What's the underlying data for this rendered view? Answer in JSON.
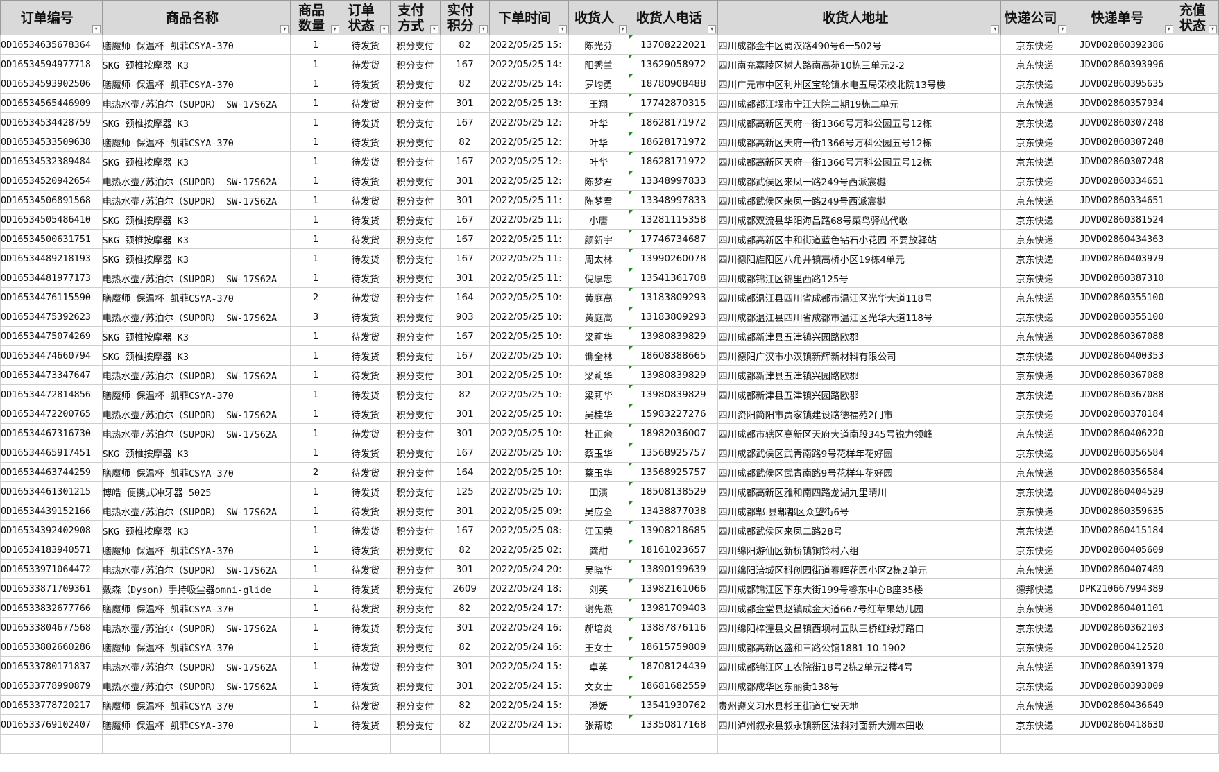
{
  "sheet": {
    "headers": [
      {
        "key": "order_id",
        "label": "订单编号"
      },
      {
        "key": "product",
        "label": "商品名称"
      },
      {
        "key": "qty",
        "label": "商品数量"
      },
      {
        "key": "status",
        "label": "订单状态"
      },
      {
        "key": "payment",
        "label": "支付方式"
      },
      {
        "key": "paid",
        "label": "实付积分"
      },
      {
        "key": "time",
        "label": "下单时间"
      },
      {
        "key": "receiver",
        "label": "收货人"
      },
      {
        "key": "phone",
        "label": "收货人电话"
      },
      {
        "key": "address",
        "label": "收货人地址"
      },
      {
        "key": "courier",
        "label": "快递公司"
      },
      {
        "key": "tracking",
        "label": "快递单号"
      },
      {
        "key": "recharge",
        "label": "充值状态"
      }
    ],
    "filter_icon": "dropdown-arrow-icon",
    "accent_colors": {
      "header_bg": "#d9d9d9",
      "grid": "#cfcfcf",
      "comment_marker": "#1a8a1a"
    },
    "rows": [
      [
        "OD16534635678364",
        "膳魔师 保温杯 凯菲CSYA-370",
        "1",
        "待发货",
        "积分支付",
        "82",
        "2022/05/25 15:",
        "陈光芬",
        "13708222021",
        "四川成都金牛区蜀汉路490号6一502号",
        "京东快递",
        "JDVD02860392386",
        ""
      ],
      [
        "OD16534594977718",
        "SKG 颈椎按摩器 K3",
        "1",
        "待发货",
        "积分支付",
        "167",
        "2022/05/25 14:",
        "阳秀兰",
        "13629058972",
        "四川南充嘉陵区树人路南高苑10栋三单元2-2",
        "京东快递",
        "JDVD02860393996",
        ""
      ],
      [
        "OD16534593902506",
        "膳魔师 保温杯 凯菲CSYA-370",
        "1",
        "待发货",
        "积分支付",
        "82",
        "2022/05/25 14:",
        "罗均勇",
        "18780908488",
        "四川广元市中区利州区宝轮镇水电五局荣校北院13号楼",
        "京东快递",
        "JDVD02860395635",
        ""
      ],
      [
        "OD16534565446909",
        "电热水壶/苏泊尔（SUPOR） SW-17S62A",
        "1",
        "待发货",
        "积分支付",
        "301",
        "2022/05/25 13:",
        "王翔",
        "17742870315",
        "四川成都都江堰市宁江大院二期19栋二单元",
        "京东快递",
        "JDVD02860357934",
        ""
      ],
      [
        "OD16534534428759",
        "SKG 颈椎按摩器 K3",
        "1",
        "待发货",
        "积分支付",
        "167",
        "2022/05/25 12:",
        "叶华",
        "18628171972",
        "四川成都高新区天府一街1366号万科公园五号12栋",
        "京东快递",
        "JDVD02860307248",
        ""
      ],
      [
        "OD16534533509638",
        "膳魔师 保温杯 凯菲CSYA-370",
        "1",
        "待发货",
        "积分支付",
        "82",
        "2022/05/25 12:",
        "叶华",
        "18628171972",
        "四川成都高新区天府一街1366号万科公园五号12栋",
        "京东快递",
        "JDVD02860307248",
        ""
      ],
      [
        "OD16534532389484",
        "SKG 颈椎按摩器 K3",
        "1",
        "待发货",
        "积分支付",
        "167",
        "2022/05/25 12:",
        "叶华",
        "18628171972",
        "四川成都高新区天府一街1366号万科公园五号12栋",
        "京东快递",
        "JDVD02860307248",
        ""
      ],
      [
        "OD16534520942654",
        "电热水壶/苏泊尔（SUPOR） SW-17S62A",
        "1",
        "待发货",
        "积分支付",
        "301",
        "2022/05/25 12:",
        "陈梦君",
        "13348997833",
        "四川成都武侯区来凤一路249号西派宸樾",
        "京东快递",
        "JDVD02860334651",
        ""
      ],
      [
        "OD16534506891568",
        "电热水壶/苏泊尔（SUPOR） SW-17S62A",
        "1",
        "待发货",
        "积分支付",
        "301",
        "2022/05/25 11:",
        "陈梦君",
        "13348997833",
        "四川成都武侯区来凤一路249号西派宸樾",
        "京东快递",
        "JDVD02860334651",
        ""
      ],
      [
        "OD16534505486410",
        "SKG 颈椎按摩器 K3",
        "1",
        "待发货",
        "积分支付",
        "167",
        "2022/05/25 11:",
        "小唐",
        "13281115358",
        "四川成都双流县华阳海昌路68号菜鸟驿站代收",
        "京东快递",
        "JDVD02860381524",
        ""
      ],
      [
        "OD16534500631751",
        "SKG 颈椎按摩器 K3",
        "1",
        "待发货",
        "积分支付",
        "167",
        "2022/05/25 11:",
        "颜新宇",
        "17746734687",
        "四川成都高新区中和街道蓝色钻石小花园 不要放驿站",
        "京东快递",
        "JDVD02860434363",
        ""
      ],
      [
        "OD16534489218193",
        "SKG 颈椎按摩器 K3",
        "1",
        "待发货",
        "积分支付",
        "167",
        "2022/05/25 11:",
        "周太林",
        "13990260078",
        "四川德阳旌阳区八角井镇高桥小区19栋4单元",
        "京东快递",
        "JDVD02860403979",
        ""
      ],
      [
        "OD16534481977173",
        "电热水壶/苏泊尔（SUPOR） SW-17S62A",
        "1",
        "待发货",
        "积分支付",
        "301",
        "2022/05/25 11:",
        "倪厚忠",
        "13541361708",
        "四川成都锦江区锦里西路125号",
        "京东快递",
        "JDVD02860387310",
        ""
      ],
      [
        "OD16534476115590",
        "膳魔师 保温杯 凯菲CSYA-370",
        "2",
        "待发货",
        "积分支付",
        "164",
        "2022/05/25 10:",
        "黄庭高",
        "13183809293",
        "四川成都温江县四川省成都市温江区光华大道118号",
        "京东快递",
        "JDVD02860355100",
        ""
      ],
      [
        "OD16534475392623",
        "电热水壶/苏泊尔（SUPOR） SW-17S62A",
        "3",
        "待发货",
        "积分支付",
        "903",
        "2022/05/25 10:",
        "黄庭高",
        "13183809293",
        "四川成都温江县四川省成都市温江区光华大道118号",
        "京东快递",
        "JDVD02860355100",
        ""
      ],
      [
        "OD16534475074269",
        "SKG 颈椎按摩器 K3",
        "1",
        "待发货",
        "积分支付",
        "167",
        "2022/05/25 10:",
        "梁莉华",
        "13980839829",
        "四川成都新津县五津镇兴园路欧郡",
        "京东快递",
        "JDVD02860367088",
        ""
      ],
      [
        "OD16534474660794",
        "SKG 颈椎按摩器 K3",
        "1",
        "待发货",
        "积分支付",
        "167",
        "2022/05/25 10:",
        "谯全林",
        "18608388665",
        "四川德阳广汉市小汉镇新辉新材料有限公司",
        "京东快递",
        "JDVD02860400353",
        ""
      ],
      [
        "OD16534473347647",
        "电热水壶/苏泊尔（SUPOR） SW-17S62A",
        "1",
        "待发货",
        "积分支付",
        "301",
        "2022/05/25 10:",
        "梁莉华",
        "13980839829",
        "四川成都新津县五津镇兴园路欧郡",
        "京东快递",
        "JDVD02860367088",
        ""
      ],
      [
        "OD16534472814856",
        "膳魔师 保温杯 凯菲CSYA-370",
        "1",
        "待发货",
        "积分支付",
        "82",
        "2022/05/25 10:",
        "梁莉华",
        "13980839829",
        "四川成都新津县五津镇兴园路欧郡",
        "京东快递",
        "JDVD02860367088",
        ""
      ],
      [
        "OD16534472200765",
        "电热水壶/苏泊尔（SUPOR） SW-17S62A",
        "1",
        "待发货",
        "积分支付",
        "301",
        "2022/05/25 10:",
        "吴桂华",
        "15983227276",
        "四川资阳简阳市贾家镇建设路德福苑2门市",
        "京东快递",
        "JDVD02860378184",
        ""
      ],
      [
        "OD16534467316730",
        "电热水壶/苏泊尔（SUPOR） SW-17S62A",
        "1",
        "待发货",
        "积分支付",
        "301",
        "2022/05/25 10:",
        "杜正余",
        "18982036007",
        "四川成都市辖区高新区天府大道南段345号锐力领峰",
        "京东快递",
        "JDVD02860406220",
        ""
      ],
      [
        "OD16534465917451",
        "SKG 颈椎按摩器 K3",
        "1",
        "待发货",
        "积分支付",
        "167",
        "2022/05/25 10:",
        "蔡玉华",
        "13568925757",
        "四川成都武侯区武青南路9号花样年花好园",
        "京东快递",
        "JDVD02860356584",
        ""
      ],
      [
        "OD16534463744259",
        "膳魔师 保温杯 凯菲CSYA-370",
        "2",
        "待发货",
        "积分支付",
        "164",
        "2022/05/25 10:",
        "蔡玉华",
        "13568925757",
        "四川成都武侯区武青南路9号花样年花好园",
        "京东快递",
        "JDVD02860356584",
        ""
      ],
      [
        "OD16534461301215",
        "博皓 便携式冲牙器 5025",
        "1",
        "待发货",
        "积分支付",
        "125",
        "2022/05/25 10:",
        "田演",
        "18508138529",
        "四川成都高新区雅和南四路龙湖九里晴川",
        "京东快递",
        "JDVD02860404529",
        ""
      ],
      [
        "OD16534439152166",
        "电热水壶/苏泊尔（SUPOR） SW-17S62A",
        "1",
        "待发货",
        "积分支付",
        "301",
        "2022/05/25 09:",
        "吴应全",
        "13438877038",
        "四川成都郫 县郫都区众望街6号",
        "京东快递",
        "JDVD02860359635",
        ""
      ],
      [
        "OD16534392402908",
        "SKG 颈椎按摩器 K3",
        "1",
        "待发货",
        "积分支付",
        "167",
        "2022/05/25 08:",
        "江国荣",
        "13908218685",
        "四川成都武侯区来凤二路28号",
        "京东快递",
        "JDVD02860415184",
        ""
      ],
      [
        "OD16534183940571",
        "膳魔师 保温杯 凯菲CSYA-370",
        "1",
        "待发货",
        "积分支付",
        "82",
        "2022/05/25 02:",
        "龚甜",
        "18161023657",
        "四川绵阳游仙区新桥镇铜铃村六组",
        "京东快递",
        "JDVD02860405609",
        ""
      ],
      [
        "OD16533971064472",
        "电热水壶/苏泊尔（SUPOR） SW-17S62A",
        "1",
        "待发货",
        "积分支付",
        "301",
        "2022/05/24 20:",
        "吴晓华",
        "13890199639",
        "四川绵阳涪城区科创园街道春晖花园小区2栋2单元",
        "京东快递",
        "JDVD02860407489",
        ""
      ],
      [
        "OD16533871709361",
        "戴森（Dyson）手持吸尘器omni-glide",
        "1",
        "待发货",
        "积分支付",
        "2609",
        "2022/05/24 18:",
        "刘英",
        "13982161066",
        "四川成都锦江区下东大街199号睿东中心B座35楼",
        "德邦快递",
        "DPK210667994389",
        ""
      ],
      [
        "OD16533832677766",
        "膳魔师 保温杯 凯菲CSYA-370",
        "1",
        "待发货",
        "积分支付",
        "82",
        "2022/05/24 17:",
        "谢先燕",
        "13981709403",
        "四川成都金堂县赵镇成金大道667号红苹果幼儿园",
        "京东快递",
        "JDVD02860401101",
        ""
      ],
      [
        "OD16533804677568",
        "电热水壶/苏泊尔（SUPOR） SW-17S62A",
        "1",
        "待发货",
        "积分支付",
        "301",
        "2022/05/24 16:",
        "郝培炎",
        "13887876116",
        "四川绵阳梓潼县文昌镇西坝村五队三桥红绿灯路口",
        "京东快递",
        "JDVD02860362103",
        ""
      ],
      [
        "OD16533802660286",
        "膳魔师 保温杯 凯菲CSYA-370",
        "1",
        "待发货",
        "积分支付",
        "82",
        "2022/05/24 16:",
        "王女士",
        "18615759809",
        "四川成都高新区盛和三路公馆1881  10-1902",
        "京东快递",
        "JDVD02860412520",
        ""
      ],
      [
        "OD16533780171837",
        "电热水壶/苏泊尔（SUPOR） SW-17S62A",
        "1",
        "待发货",
        "积分支付",
        "301",
        "2022/05/24 15:",
        "卓英",
        "18708124439",
        "四川成都锦江区工农院街18号2栋2单元2楼4号",
        "京东快递",
        "JDVD02860391379",
        ""
      ],
      [
        "OD16533778990879",
        "电热水壶/苏泊尔（SUPOR） SW-17S62A",
        "1",
        "待发货",
        "积分支付",
        "301",
        "2022/05/24 15:",
        "文女士",
        "18681682559",
        "四川成都成华区东丽街138号",
        "京东快递",
        "JDVD02860393009",
        ""
      ],
      [
        "OD16533778720217",
        "膳魔师 保温杯 凯菲CSYA-370",
        "1",
        "待发货",
        "积分支付",
        "82",
        "2022/05/24 15:",
        "潘媛",
        "13541930762",
        "贵州遵义习水县杉王街道仁安天地",
        "京东快递",
        "JDVD02860436649",
        ""
      ],
      [
        "OD16533769102407",
        "膳魔师 保温杯 凯菲CSYA-370",
        "1",
        "待发货",
        "积分支付",
        "82",
        "2022/05/24 15:",
        "张帮琼",
        "13350817168",
        "四川泸州叙永县叙永镇新区法斜对面新大洲本田收",
        "京东快递",
        "JDVD02860418630",
        ""
      ],
      [
        "",
        "",
        "",
        "",
        "",
        "",
        "",
        "",
        "",
        "",
        "",
        "",
        ""
      ]
    ]
  }
}
